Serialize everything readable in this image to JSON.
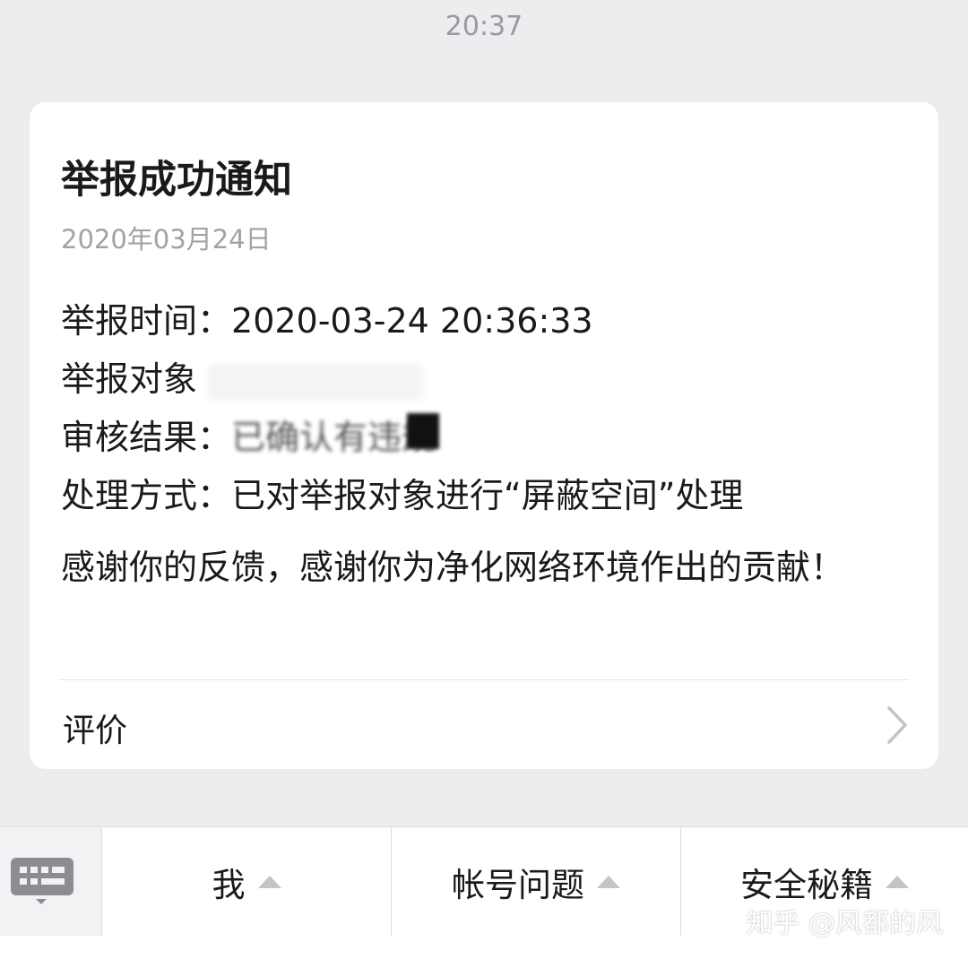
{
  "status_time": "20:37",
  "card": {
    "title": "举报成功通知",
    "date": "2020年03月24日",
    "rows": [
      {
        "label": "举报时间：",
        "value": "2020-03-24 20:36:33"
      },
      {
        "label": "举报对象",
        "value": ""
      },
      {
        "label": "审核结果：",
        "value": "已确认有违规"
      },
      {
        "label": "处理方式：",
        "value": "已对举报对象进行“屏蔽空间”处理"
      }
    ],
    "thanks": "感谢你的反馈，感谢你为净化网络环境作出的贡献！",
    "rate_label": "评价"
  },
  "bottom_menu": {
    "items": [
      "我",
      "帐号问题",
      "安全秘籍"
    ]
  },
  "watermark": "知乎 @风都的风",
  "icons": {
    "keyboard": "keyboard-icon",
    "chevron": "chevron-right-icon",
    "menu_arrow": "triangle-up-icon"
  }
}
